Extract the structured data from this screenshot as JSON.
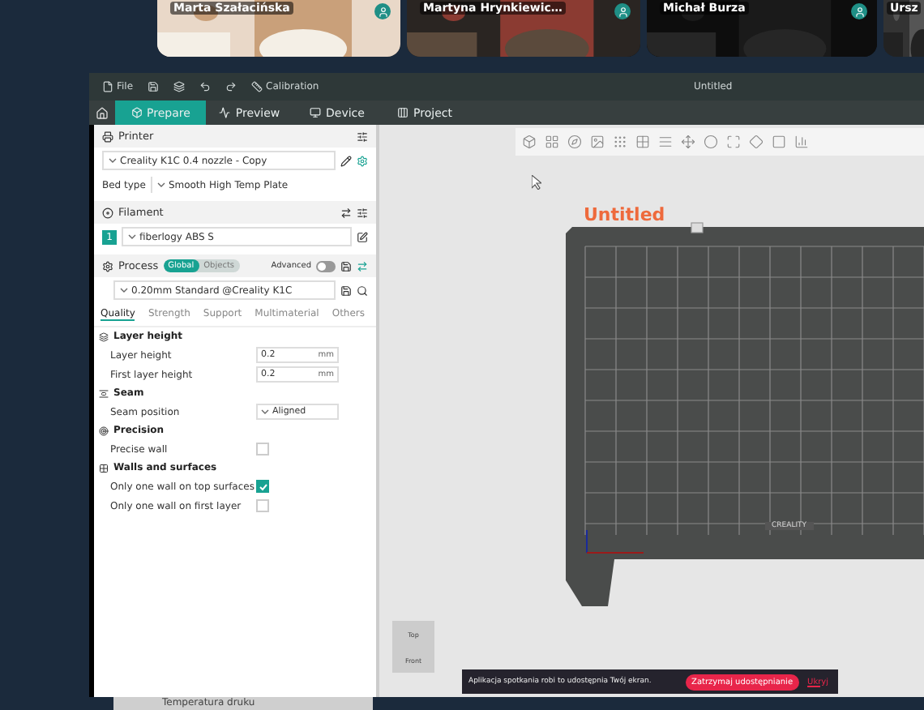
{
  "participants": [
    {
      "name": "Marta Szałacińska"
    },
    {
      "name": "Martyna Hrynkiewic…"
    },
    {
      "name": "Michał Burza"
    },
    {
      "name": "Ursz"
    }
  ],
  "titlebar": {
    "file": "File",
    "calibration": "Calibration",
    "title": "Untitled"
  },
  "tabs": [
    {
      "label": "Prepare",
      "selected": true
    },
    {
      "label": "Preview",
      "selected": false
    },
    {
      "label": "Device",
      "selected": false
    },
    {
      "label": "Project",
      "selected": false
    }
  ],
  "printer": {
    "title": "Printer",
    "preset": "Creality K1C 0.4 nozzle - Copy",
    "bed_type_label": "Bed type",
    "bed_type": "Smooth High Temp Plate"
  },
  "filament": {
    "title": "Filament",
    "slots": [
      {
        "number": "1",
        "name": "fiberlogy ABS S"
      }
    ]
  },
  "process": {
    "title": "Process",
    "scope": [
      {
        "label": "Global",
        "selected": true
      },
      {
        "label": "Objects",
        "selected": false
      }
    ],
    "advanced_label": "Advanced",
    "advanced_on": false,
    "preset": "0.20mm Standard @Creality K1C",
    "tabs": [
      {
        "label": "Quality",
        "selected": true
      },
      {
        "label": "Strength",
        "selected": false
      },
      {
        "label": "Support",
        "selected": false
      },
      {
        "label": "Multimaterial",
        "selected": false
      },
      {
        "label": "Others",
        "selected": false
      }
    ],
    "groups": [
      {
        "title": "Layer height",
        "options": [
          {
            "kind": "number",
            "label": "Layer height",
            "value": "0.2",
            "unit": "mm"
          },
          {
            "kind": "number",
            "label": "First layer height",
            "value": "0.2",
            "unit": "mm"
          }
        ]
      },
      {
        "title": "Seam",
        "options": [
          {
            "kind": "select",
            "label": "Seam position",
            "value": "Aligned"
          }
        ]
      },
      {
        "title": "Precision",
        "options": [
          {
            "kind": "checkbox",
            "label": "Precise wall",
            "checked": false
          }
        ]
      },
      {
        "title": "Walls and surfaces",
        "options": [
          {
            "kind": "checkbox",
            "label": "Only one wall on top surfaces",
            "checked": true
          },
          {
            "kind": "checkbox",
            "label": "Only one wall on first layer",
            "checked": false
          }
        ]
      }
    ]
  },
  "canvas": {
    "plate_name": "Untitled",
    "plate_brand": "CREALITY",
    "view_cube": {
      "top": "Top",
      "front": "Front"
    }
  },
  "share_bar": {
    "message": "Aplikacja spotkania robi to udostępnia Twój ekran.",
    "stop": "Zatrzymaj udostępnianie",
    "hide": "Ukryj"
  },
  "footer": {
    "label": "Temperatura druku"
  }
}
